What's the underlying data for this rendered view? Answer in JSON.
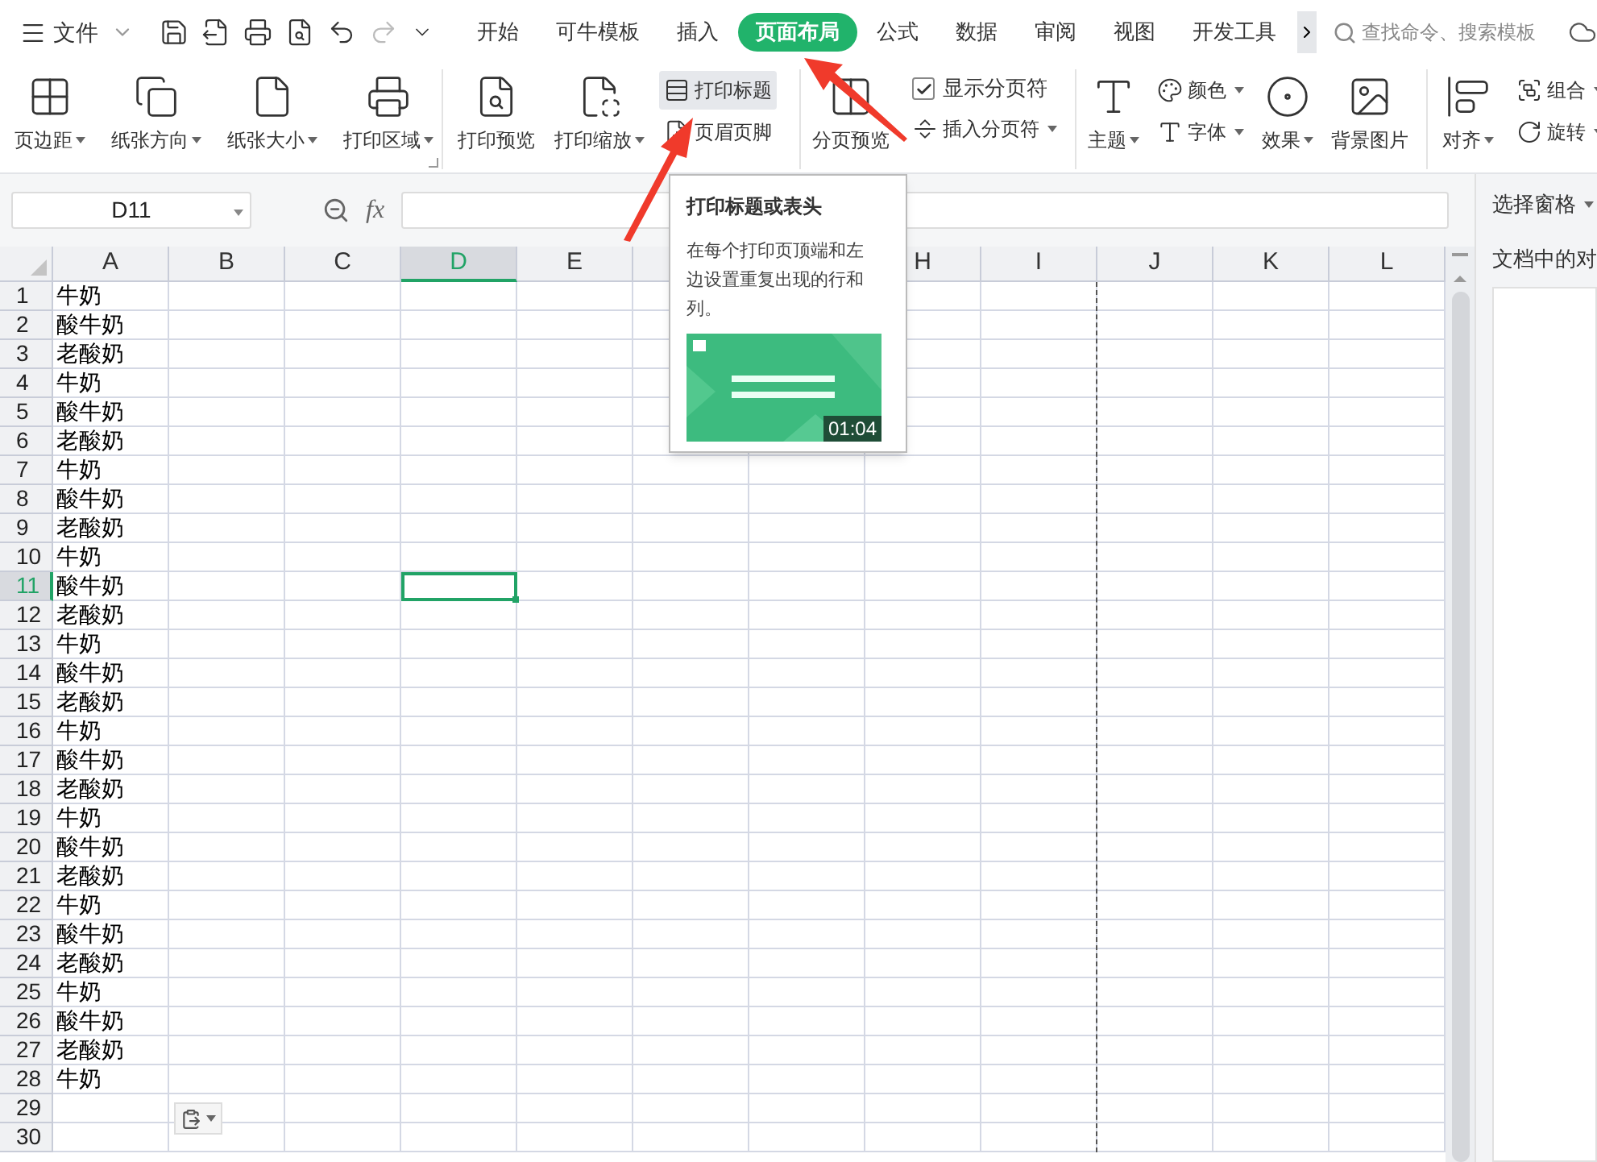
{
  "file_menu": {
    "label": "文件"
  },
  "tabs": [
    {
      "label": "开始",
      "selected": false
    },
    {
      "label": "可牛模板",
      "selected": false
    },
    {
      "label": "插入",
      "selected": false
    },
    {
      "label": "页面布局",
      "selected": true
    },
    {
      "label": "公式",
      "selected": false
    },
    {
      "label": "数据",
      "selected": false
    },
    {
      "label": "审阅",
      "selected": false
    },
    {
      "label": "视图",
      "selected": false
    },
    {
      "label": "开发工具",
      "selected": false
    }
  ],
  "search": {
    "placeholder": "查找命令、搜索模板"
  },
  "ribbon": [
    {
      "launcher": true,
      "items": [
        {
          "kind": "large",
          "label": "页边距",
          "menu": true,
          "hovered": false
        },
        {
          "kind": "large",
          "label": "纸张方向",
          "menu": true,
          "hovered": false
        },
        {
          "kind": "large",
          "label": "纸张大小",
          "menu": true,
          "hovered": false
        },
        {
          "kind": "large",
          "label": "打印区域",
          "menu": true,
          "hovered": false
        }
      ]
    },
    {
      "items": [
        {
          "kind": "large",
          "label": "打印预览",
          "menu": false,
          "hovered": false
        },
        {
          "kind": "large",
          "label": "打印缩放",
          "menu": true,
          "hovered": false
        },
        {
          "kind": "stack",
          "items": [
            {
              "kind": "small",
              "label": "打印标题",
              "menu": false,
              "hovered": true
            },
            {
              "kind": "small",
              "label": "页眉页脚",
              "menu": false,
              "hovered": false
            }
          ]
        }
      ]
    },
    {
      "items": [
        {
          "kind": "large",
          "label": "分页预览",
          "menu": false,
          "hovered": false
        },
        {
          "kind": "stack",
          "items": [
            {
              "kind": "checkbox",
              "label": "显示分页符",
              "checked": true
            },
            {
              "kind": "small",
              "label": "插入分页符",
              "menu": true,
              "hovered": false
            }
          ]
        }
      ]
    },
    {
      "items": [
        {
          "kind": "large",
          "label": "主题",
          "menu": true,
          "hovered": false
        },
        {
          "kind": "stack",
          "items": [
            {
              "kind": "small",
              "label": "颜色",
              "menu": true,
              "hovered": false
            },
            {
              "kind": "small",
              "label": "字体",
              "menu": true,
              "hovered": false
            }
          ]
        },
        {
          "kind": "large",
          "label": "效果",
          "menu": true,
          "hovered": false
        },
        {
          "kind": "large",
          "label": "背景图片",
          "menu": false,
          "hovered": false
        }
      ]
    },
    {
      "items": [
        {
          "kind": "large",
          "label": "对齐",
          "menu": true,
          "hovered": false
        },
        {
          "kind": "stack",
          "items": [
            {
              "kind": "small",
              "label": "组合",
              "menu": true,
              "hovered": false
            },
            {
              "kind": "small",
              "label": "旋转",
              "menu": true,
              "hovered": false
            }
          ]
        }
      ]
    }
  ],
  "name_box": {
    "value": "D11"
  },
  "formula_label": "fx",
  "side_panel": {
    "title": "选择窗格",
    "heading": "文档中的对"
  },
  "columns": [
    {
      "kind": "normal",
      "label": "A",
      "selected": false
    },
    {
      "kind": "normal",
      "label": "B",
      "selected": false
    },
    {
      "kind": "normal",
      "label": "C",
      "selected": false
    },
    {
      "kind": "normal",
      "label": "D",
      "selected": true
    },
    {
      "kind": "normal",
      "label": "E",
      "selected": false
    },
    {
      "kind": "covered",
      "selected": false
    },
    {
      "kind": "covered"
    },
    {
      "kind": "normal",
      "label": "H",
      "selected": false
    },
    {
      "kind": "normal",
      "label": "I",
      "selected": false,
      "page_break": true
    },
    {
      "kind": "normal",
      "label": "J",
      "selected": false
    },
    {
      "kind": "normal",
      "label": "K",
      "selected": false
    },
    {
      "kind": "normal",
      "label": "L",
      "selected": false
    }
  ],
  "rows": [
    {
      "number": "1",
      "a": "牛奶",
      "selected": false
    },
    {
      "number": "2",
      "a": "酸牛奶",
      "selected": false
    },
    {
      "number": "3",
      "a": "老酸奶",
      "selected": false
    },
    {
      "number": "4",
      "a": "牛奶",
      "selected": false
    },
    {
      "number": "5",
      "a": "酸牛奶",
      "selected": false
    },
    {
      "number": "6",
      "a": "老酸奶",
      "selected": false
    },
    {
      "number": "7",
      "a": "牛奶",
      "selected": false
    },
    {
      "number": "8",
      "a": "酸牛奶",
      "selected": false
    },
    {
      "number": "9",
      "a": "老酸奶",
      "selected": false
    },
    {
      "number": "10",
      "a": "牛奶",
      "selected": false
    },
    {
      "number": "11",
      "a": "酸牛奶",
      "selected": true
    },
    {
      "number": "12",
      "a": "老酸奶",
      "selected": false
    },
    {
      "number": "13",
      "a": "牛奶",
      "selected": false
    },
    {
      "number": "14",
      "a": "酸牛奶",
      "selected": false
    },
    {
      "number": "15",
      "a": "老酸奶",
      "selected": false
    },
    {
      "number": "16",
      "a": "牛奶",
      "selected": false
    },
    {
      "number": "17",
      "a": "酸牛奶",
      "selected": false
    },
    {
      "number": "18",
      "a": "老酸奶",
      "selected": false
    },
    {
      "number": "19",
      "a": "牛奶",
      "selected": false
    },
    {
      "number": "20",
      "a": "酸牛奶",
      "selected": false
    },
    {
      "number": "21",
      "a": "老酸奶",
      "selected": false
    },
    {
      "number": "22",
      "a": "牛奶",
      "selected": false
    },
    {
      "number": "23",
      "a": "酸牛奶",
      "selected": false
    },
    {
      "number": "24",
      "a": "老酸奶",
      "selected": false
    },
    {
      "number": "25",
      "a": "牛奶",
      "selected": false
    },
    {
      "number": "26",
      "a": "酸牛奶",
      "selected": false
    },
    {
      "number": "27",
      "a": "老酸奶",
      "selected": false
    },
    {
      "number": "28",
      "a": "牛奶",
      "selected": false
    },
    {
      "number": "29",
      "selected": false
    },
    {
      "number": "30",
      "selected": false
    }
  ],
  "tooltip": {
    "title": "打印标题或表头",
    "body": "在每个打印页顶端和左边设置重复出现的行和列。",
    "video": {
      "kind": "picture",
      "duration": "01:04"
    }
  }
}
